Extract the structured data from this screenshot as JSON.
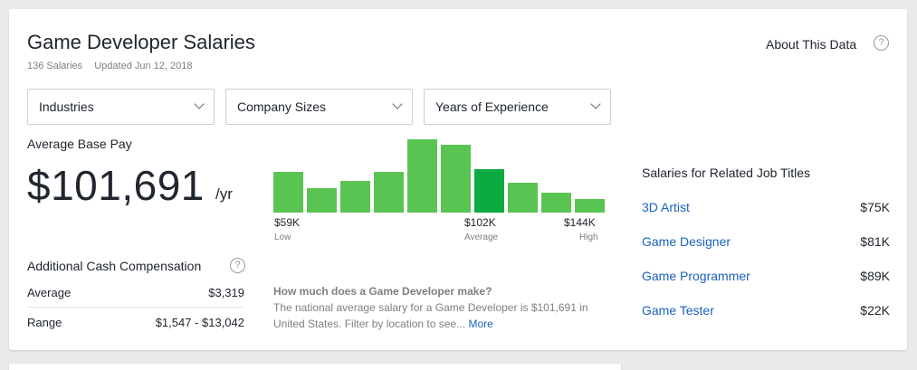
{
  "header": {
    "title": "Game Developer Salaries",
    "salaries_count": "136 Salaries",
    "updated": "Updated Jun 12, 2018",
    "about_label": "About This Data",
    "help_glyph": "?"
  },
  "filters": [
    {
      "label": "Industries"
    },
    {
      "label": "Company Sizes"
    },
    {
      "label": "Years of Experience"
    }
  ],
  "average_base_pay": {
    "label": "Average Base Pay",
    "value": "$101,691",
    "period": "/yr"
  },
  "chart_data": {
    "type": "bar",
    "values": [
      44,
      27,
      35,
      44,
      80,
      74,
      47,
      33,
      22,
      15
    ],
    "highlight_index": 6,
    "ticks": [
      {
        "value": "$59K",
        "sub": "Low"
      },
      {
        "value": "$102K",
        "sub": "Average"
      },
      {
        "value": "$144K",
        "sub": "High"
      }
    ],
    "bar_color": "#5ac453",
    "highlight_color": "#0caa41"
  },
  "additional_cash": {
    "label": "Additional Cash Compensation",
    "rows": [
      {
        "label": "Average",
        "value": "$3,319"
      },
      {
        "label": "Range",
        "value": "$1,547 - $13,042"
      }
    ]
  },
  "how_much": {
    "question": "How much does a Game Developer make?",
    "description": "The national average salary for a Game Developer is $101,691 in United States. Filter by location to see...",
    "more_label": "More"
  },
  "related": {
    "title": "Salaries for Related Job Titles",
    "items": [
      {
        "name": "3D Artist",
        "amount": "$75K"
      },
      {
        "name": "Game Designer",
        "amount": "$81K"
      },
      {
        "name": "Game Programmer",
        "amount": "$89K"
      },
      {
        "name": "Game Tester",
        "amount": "$22K"
      }
    ]
  },
  "colors": {
    "link": "#1861bf",
    "text": "#20262e",
    "muted": "#7f7f7f"
  }
}
